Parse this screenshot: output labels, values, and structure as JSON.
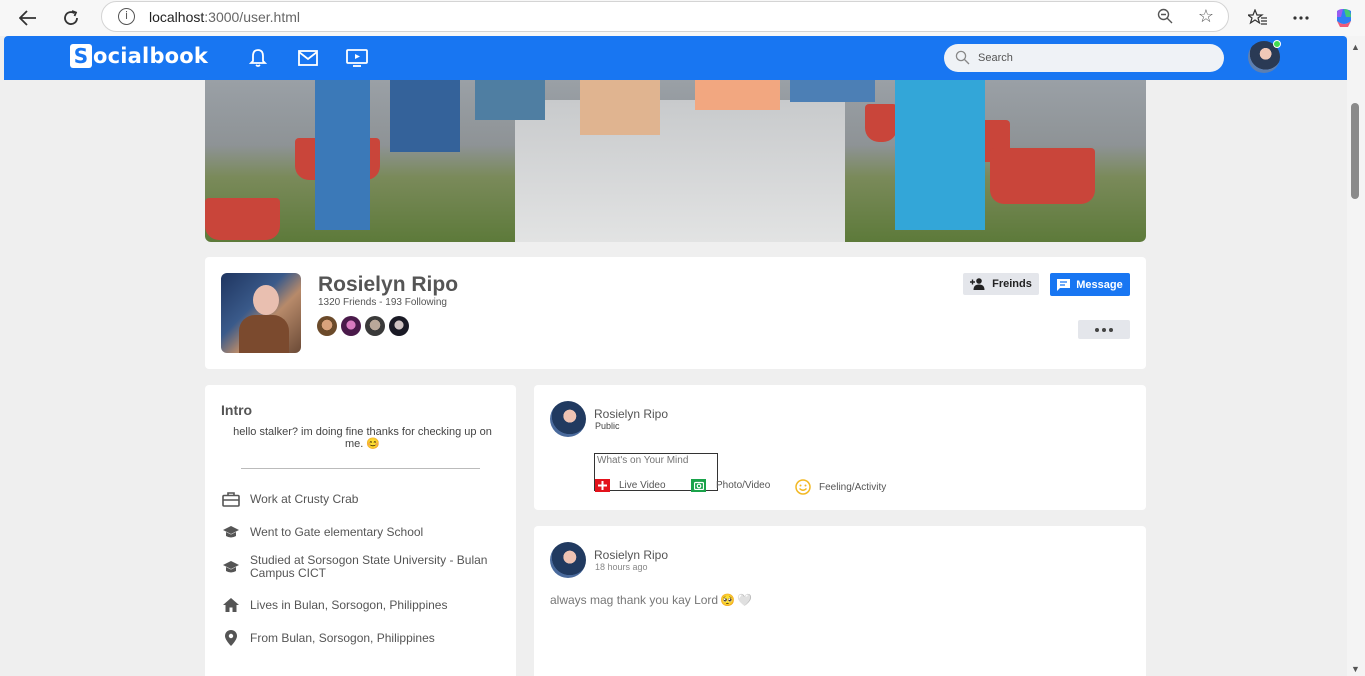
{
  "browser": {
    "url_host": "localhost",
    "url_path": ":3000/user.html"
  },
  "nav": {
    "logo_letter": "S",
    "logo_text": "ocialbook",
    "search_placeholder": "Search"
  },
  "profile": {
    "name": "Rosielyn Ripo",
    "counts": "1320 Friends - 193 Following",
    "friends_button": "Freinds",
    "message_button": "Message"
  },
  "intro": {
    "title": "Intro",
    "bio": "hello stalker? im doing fine thanks for checking up on me.",
    "bio_emoji": "😊",
    "items": [
      {
        "icon": "briefcase-icon",
        "text": "Work at Crusty Crab"
      },
      {
        "icon": "graduation-cap-icon",
        "text": "Went to Gate elementary School"
      },
      {
        "icon": "graduation-cap-icon",
        "text": "Studied at Sorsogon State University - Bulan Campus CICT"
      },
      {
        "icon": "home-icon",
        "text": "Lives in Bulan, Sorsogon, Philippines"
      },
      {
        "icon": "location-pin-icon",
        "text": "From Bulan, Sorsogon, Philippines"
      }
    ]
  },
  "create_post": {
    "name": "Rosielyn Ripo",
    "privacy": "Public",
    "placeholder": "What's on Your Mind",
    "actions": {
      "live": "Live Video",
      "photo": "Photo/Video",
      "feeling": "Feeling/Activity"
    }
  },
  "post": {
    "name": "Rosielyn Ripo",
    "time": "18 hours ago",
    "text": "always mag thank you kay Lord",
    "emoji_1": "🥺",
    "emoji_2": "🤍"
  },
  "colors": {
    "brand": "#1876f2",
    "online": "#41db51"
  }
}
